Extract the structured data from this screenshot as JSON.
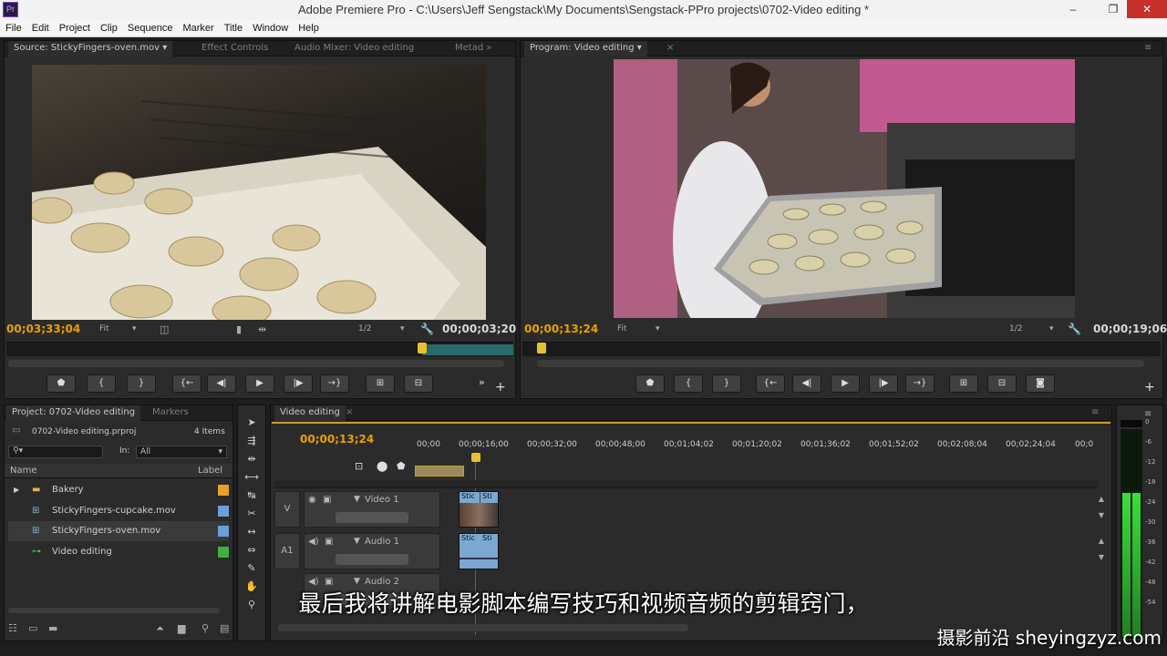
{
  "window": {
    "title": "Adobe Premiere Pro - C:\\Users\\Jeff Sengstack\\My Documents\\Sengstack-PPro projects\\0702-Video editing *",
    "logo": "Pr",
    "minimize": "–",
    "restore": "❐",
    "close": "✕"
  },
  "menu": [
    "File",
    "Edit",
    "Project",
    "Clip",
    "Sequence",
    "Marker",
    "Title",
    "Window",
    "Help"
  ],
  "source_monitor": {
    "tabs": [
      "Source: StickyFingers-oven.mov ▾",
      "Effect Controls",
      "Audio Mixer: Video editing",
      "Metad »"
    ],
    "timecode_in": "00;03;33;04",
    "fit": "Fit",
    "res": "1/2",
    "timecode_dur": "00;00;03;20"
  },
  "program_monitor": {
    "tab": "Program: Video editing ▾",
    "timecode_in": "00;00;13;24",
    "fit": "Fit",
    "res": "1/2",
    "timecode_dur": "00;00;19;06"
  },
  "project": {
    "tabs": [
      "Project: 0702-Video editing",
      "Markers"
    ],
    "file": "0702-Video editing.prproj",
    "count": "4 Items",
    "search_placeholder": "",
    "in_label": "In:",
    "in_value": "All",
    "col_name": "Name",
    "col_label": "Label",
    "items": [
      {
        "name": "Bakery",
        "icon": "folder-icon",
        "color": "#e8a030"
      },
      {
        "name": "StickyFingers-cupcake.mov",
        "icon": "clip-icon",
        "color": "#6aa0d8"
      },
      {
        "name": "StickyFingers-oven.mov",
        "icon": "clip-icon",
        "color": "#6aa0d8"
      },
      {
        "name": "Video editing",
        "icon": "sequence-icon",
        "color": "#40b040"
      }
    ]
  },
  "timeline": {
    "tab": "Video editing",
    "timecode": "00;00;13;24",
    "ticks": [
      "00;00",
      "00;00;16;00",
      "00;00;32;00",
      "00;00;48;00",
      "00;01;04;02",
      "00;01;20;02",
      "00;01;36;02",
      "00;01;52;02",
      "00;02;08;04",
      "00;02;24;04",
      "00;0"
    ],
    "tracks": [
      {
        "label": "V",
        "name": "Video 1"
      },
      {
        "label": "A1",
        "name": "Audio 1"
      },
      {
        "label": "",
        "name": "Audio 2"
      }
    ],
    "clip_labels": [
      "Stic",
      "Sti"
    ]
  },
  "meter": {
    "scale": [
      "0",
      "-6",
      "-12",
      "-18",
      "-24",
      "-30",
      "-36",
      "-42",
      "-48",
      "-54"
    ]
  },
  "subtitle": "最后我将讲解电影脚本编写技巧和视频音频的剪辑窍门，",
  "watermark": "摄影前沿 sheyingzyz.com"
}
